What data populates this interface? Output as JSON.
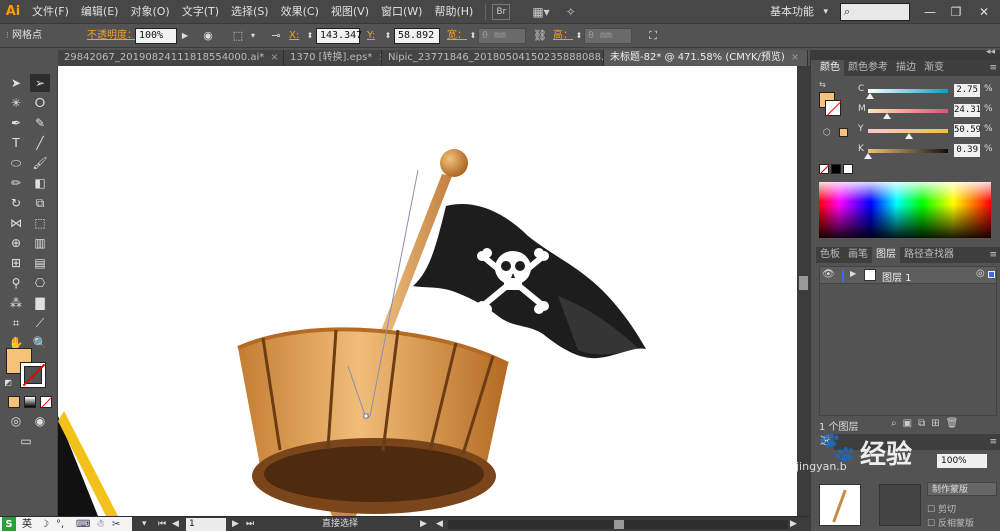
{
  "app": {
    "logo": "Ai"
  },
  "menubar": {
    "items": [
      "文件(F)",
      "编辑(E)",
      "对象(O)",
      "文字(T)",
      "选择(S)",
      "效果(C)",
      "视图(V)",
      "窗口(W)",
      "帮助(H)"
    ],
    "workspace": "基本功能",
    "search_placeholder": ""
  },
  "controlbar": {
    "selection_label": "网格点",
    "opacity_label": "不透明度：",
    "opacity_value": "100%",
    "x_label": "X:",
    "x_value": "143.347",
    "y_label": "Y:",
    "y_value": "58.892",
    "w_label": "宽：",
    "w_value": "0 mm",
    "h_label": "高：",
    "h_value": "0 mm"
  },
  "tabs": [
    {
      "label": "29842067_20190824111818554000.ai*",
      "active": false
    },
    {
      "label": "1370 [转换].eps*",
      "active": false
    },
    {
      "label": "Nipic_23771846_20180504150235888088.ai*",
      "active": false
    },
    {
      "label": "未标题-82* @ 471.58% (CMYK/预览)",
      "active": true
    }
  ],
  "statusbar": {
    "zoom": "",
    "page": "1",
    "tool_name": "直接选择"
  },
  "color_panel": {
    "tabs": [
      "颜色",
      "颜色参考",
      "描边",
      "渐变"
    ],
    "channels": [
      {
        "label": "C",
        "value": "2.75",
        "pct": "%",
        "fraction": 0.03,
        "from": "#ffffff",
        "to": "#00a0c6"
      },
      {
        "label": "M",
        "value": "24.31",
        "pct": "%",
        "fraction": 0.24,
        "from": "#ffe9b2",
        "to": "#e0507a"
      },
      {
        "label": "Y",
        "value": "50.59",
        "pct": "%",
        "fraction": 0.51,
        "from": "#f8c8d8",
        "to": "#f6c230"
      },
      {
        "label": "K",
        "value": "0.39",
        "pct": "%",
        "fraction": 0.0,
        "from": "#f5c27a",
        "to": "#111111"
      }
    ],
    "fill_color": "#f5c27a"
  },
  "layers_panel": {
    "tabs": [
      "色板",
      "画笔",
      "图层",
      "路径查找器"
    ],
    "layer_name": "图层 1",
    "count_label": "1 个图层"
  },
  "bottom_panel": {
    "tab": "透",
    "opacity_value": "100%",
    "make_mask": "制作蒙版",
    "clip_label": "剪切",
    "invert_label": "反相蒙版"
  },
  "watermark": {
    "text": "经验",
    "site": "jingyan.b"
  },
  "taskbar": {
    "ime": "英"
  }
}
